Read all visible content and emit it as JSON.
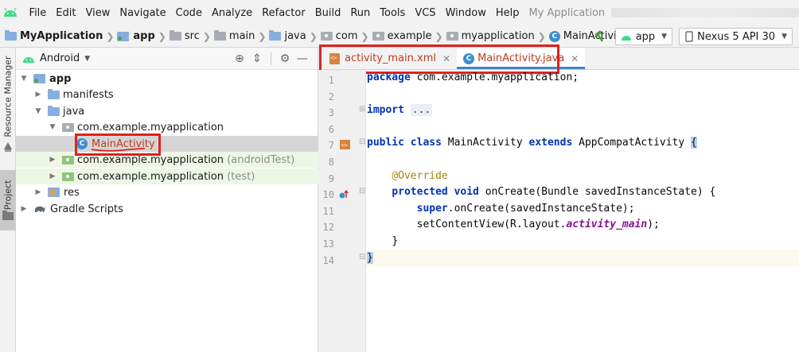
{
  "menu": {
    "items": [
      "File",
      "Edit",
      "View",
      "Navigate",
      "Code",
      "Analyze",
      "Refactor",
      "Build",
      "Run",
      "Tools",
      "VCS",
      "Window",
      "Help"
    ],
    "window_title": "My Application"
  },
  "navbar": {
    "crumbs": [
      "MyApplication",
      "app",
      "src",
      "main",
      "java",
      "com",
      "example",
      "myapplication",
      "MainActivity"
    ],
    "run_config": "app",
    "device": "Nexus 5 API 30"
  },
  "left_strip": {
    "resource_manager": "Resource Manager",
    "project": "1: Project"
  },
  "project_panel": {
    "view": "Android",
    "tree": {
      "app": "app",
      "manifests": "manifests",
      "java": "java",
      "package_main": "com.example.myapplication",
      "main_activity": "MainActivity",
      "package_android_test": "com.example.myapplication",
      "android_test_suffix": "(androidTest)",
      "package_test": "com.example.myapplication",
      "test_suffix": "(test)",
      "res": "res",
      "gradle": "Gradle Scripts"
    }
  },
  "editor": {
    "tabs": [
      {
        "label": "activity_main.xml",
        "active": false
      },
      {
        "label": "MainActivity.java",
        "active": true
      }
    ],
    "line_numbers": [
      "1",
      "2",
      "3",
      "6",
      "7",
      "8",
      "9",
      "10",
      "11",
      "12",
      "13",
      "14"
    ],
    "code": {
      "l1_kw": "package",
      "l1_rest": " com.example.myapplication;",
      "l3_kw": "import",
      "l3_fold": "...",
      "l7_kw1": "public class",
      "l7_name": " MainActivity ",
      "l7_kw2": "extends",
      "l7_super": " AppCompatActivity ",
      "l7_brace": "{",
      "l9_ann": "@Override",
      "l10_kw": "protected void",
      "l10_rest": " onCreate(Bundle savedInstanceState) {",
      "l11_kw": "super",
      "l11_rest": ".onCreate(savedInstanceState);",
      "l12_pre": "setContentView(R.layout.",
      "l12_it": "activity_main",
      "l12_post": ");",
      "l13": "}",
      "l14": "}"
    }
  },
  "colors": {
    "highlight_box": "#e02020",
    "keyword": "#0033b3",
    "annotation": "#9e880d",
    "field": "#871094",
    "tab_underline": "#4083c9"
  }
}
